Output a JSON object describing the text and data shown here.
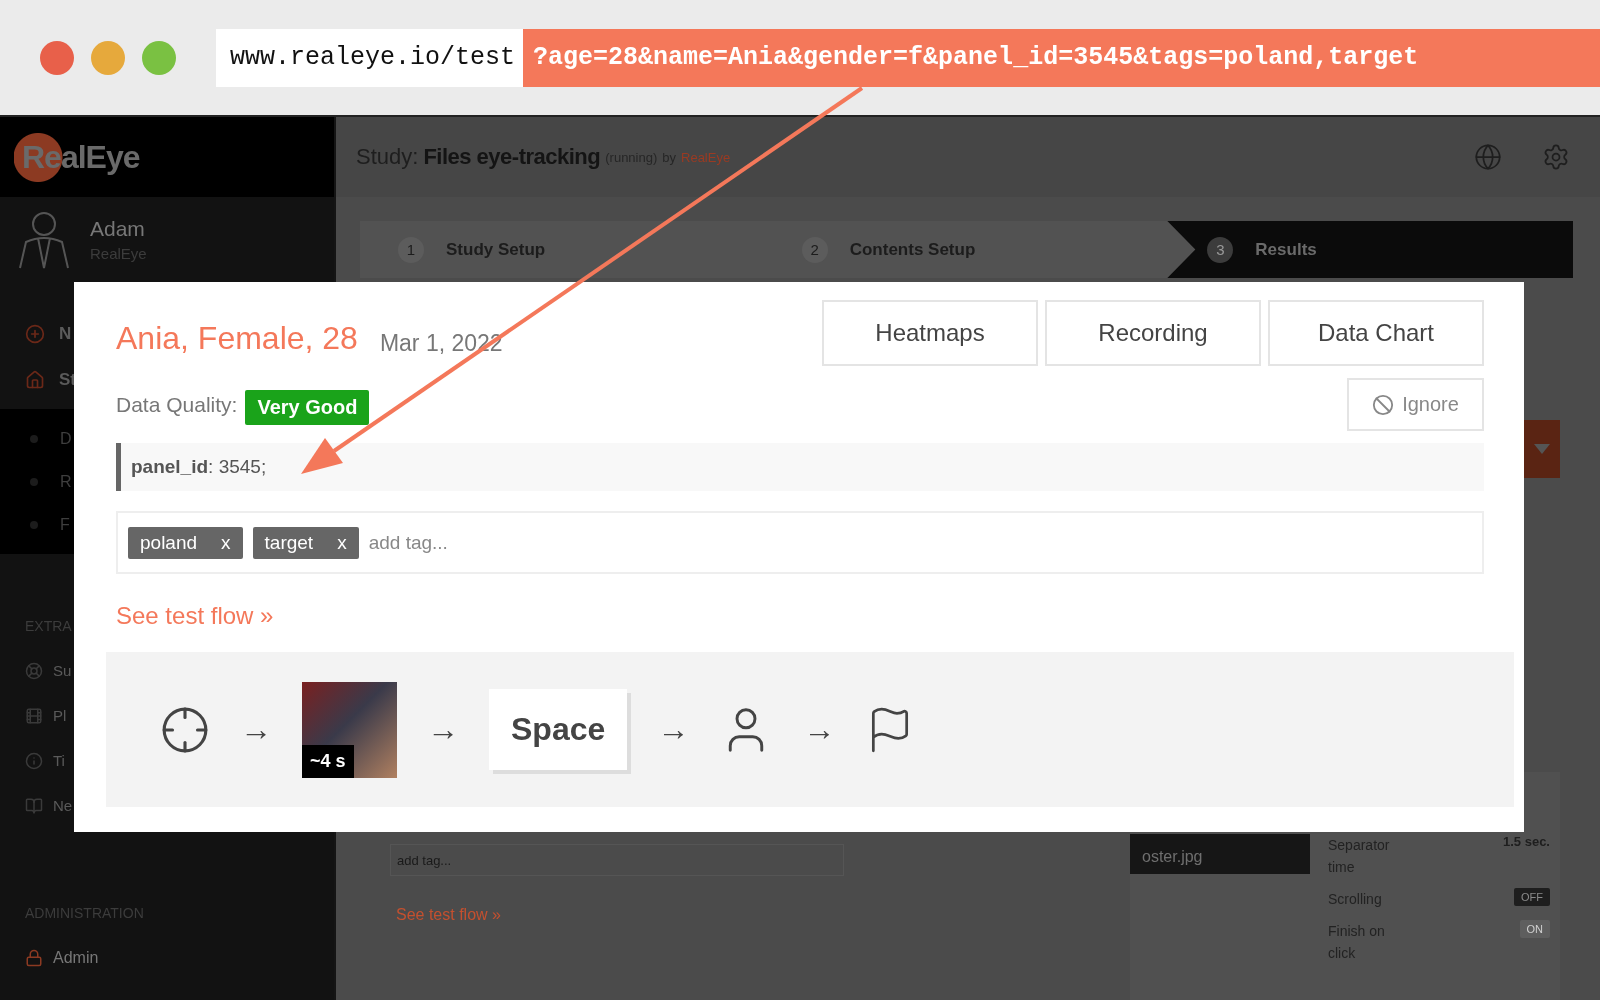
{
  "browser": {
    "url_base": "www.realeye.io/test",
    "url_query": "?age=28&name=Ania&gender=f&panel_id=3545&tags=poland,target"
  },
  "sidebar": {
    "logo": "RealEye",
    "user": {
      "name": "Adam",
      "org": "RealEye"
    },
    "nav": [
      "N",
      "St"
    ],
    "subnav": [
      "D",
      "R",
      "F"
    ],
    "extra_heading": "EXTRA",
    "extra": [
      "Su",
      "Pl",
      "Ti",
      "Ne"
    ],
    "admin_heading": "ADMINISTRATION",
    "admin": [
      "Admin"
    ]
  },
  "study": {
    "prefix": "Study:",
    "name": "Files eye-tracking",
    "status": "(running)",
    "by": "by",
    "owner": "RealEye"
  },
  "steps": [
    {
      "number": "1",
      "label": "Study Setup",
      "selected": false
    },
    {
      "number": "2",
      "label": "Contents Setup",
      "selected": false
    },
    {
      "number": "3",
      "label": "Results",
      "selected": true
    }
  ],
  "background": {
    "tag_placeholder": "add tag...",
    "flow_link": "See test flow »",
    "file_name": "oster.jpg",
    "settings": [
      {
        "kind": "text",
        "label": "Separator time",
        "value": "1.5 sec."
      },
      {
        "kind": "toggle",
        "label": "Scrolling",
        "value": "OFF",
        "on": false
      },
      {
        "kind": "toggle",
        "label": "Finish on click",
        "value": "ON",
        "on": true
      }
    ]
  },
  "modal": {
    "title": "Ania, Female, 28",
    "date": "Mar 1, 2022",
    "views": [
      "Heatmaps",
      "Recording",
      "Data Chart"
    ],
    "quality_label": "Data Quality:",
    "quality": "Very Good",
    "ignore": "Ignore",
    "params": "**panel_id**: 3545;",
    "tags": [
      {
        "label": "poland",
        "remove": "x"
      },
      {
        "label": "target",
        "remove": "x"
      }
    ],
    "tag_placeholder": "add tag...",
    "flow_link": "See test flow »",
    "flow": [
      {
        "kind": "crosshair"
      },
      {
        "kind": "arrow",
        "text": "→"
      },
      {
        "kind": "media",
        "duration": "~4 s"
      },
      {
        "kind": "arrow",
        "text": "→"
      },
      {
        "kind": "key",
        "text": "Space"
      },
      {
        "kind": "arrow",
        "text": "→"
      },
      {
        "kind": "user"
      },
      {
        "kind": "arrow",
        "text": "→"
      },
      {
        "kind": "flag"
      }
    ]
  }
}
